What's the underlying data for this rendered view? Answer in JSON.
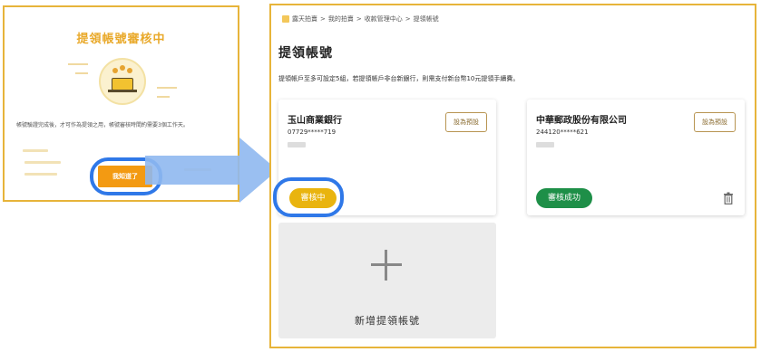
{
  "modal": {
    "title": "提領帳號審核中",
    "message": "帳號驗證完成後，才可作為提領之用，帳號審核時間約需要3個工作天。",
    "confirm_label": "我知道了"
  },
  "breadcrumb": {
    "items": [
      "露天拍賣",
      "我的拍賣",
      "收款管理中心",
      "提領帳號"
    ],
    "separator": ">"
  },
  "page": {
    "title": "提領帳號",
    "description": "提領帳戶至多可設定5組，若提領帳戶非台新銀行，則需支付新台幣10元提領手續費。"
  },
  "accounts": [
    {
      "bank_name": "玉山商業銀行",
      "account_number": "07729*****719",
      "default_label": "設為預設",
      "status_label": "審核中"
    },
    {
      "bank_name": "中華郵政股份有限公司",
      "account_number": "244120*****621",
      "default_label": "設為預設",
      "status_label": "審核成功"
    }
  ],
  "add_account": {
    "label": "新增提領帳號"
  },
  "colors": {
    "frame_border": "#e7b43a",
    "modal_title": "#e9a92a",
    "confirm_button": "#f39a12",
    "highlight_ring": "#2f78e8",
    "pending_badge": "#e9b40f",
    "approved_badge": "#1e8f48",
    "arrow": "#8fb8f0"
  }
}
